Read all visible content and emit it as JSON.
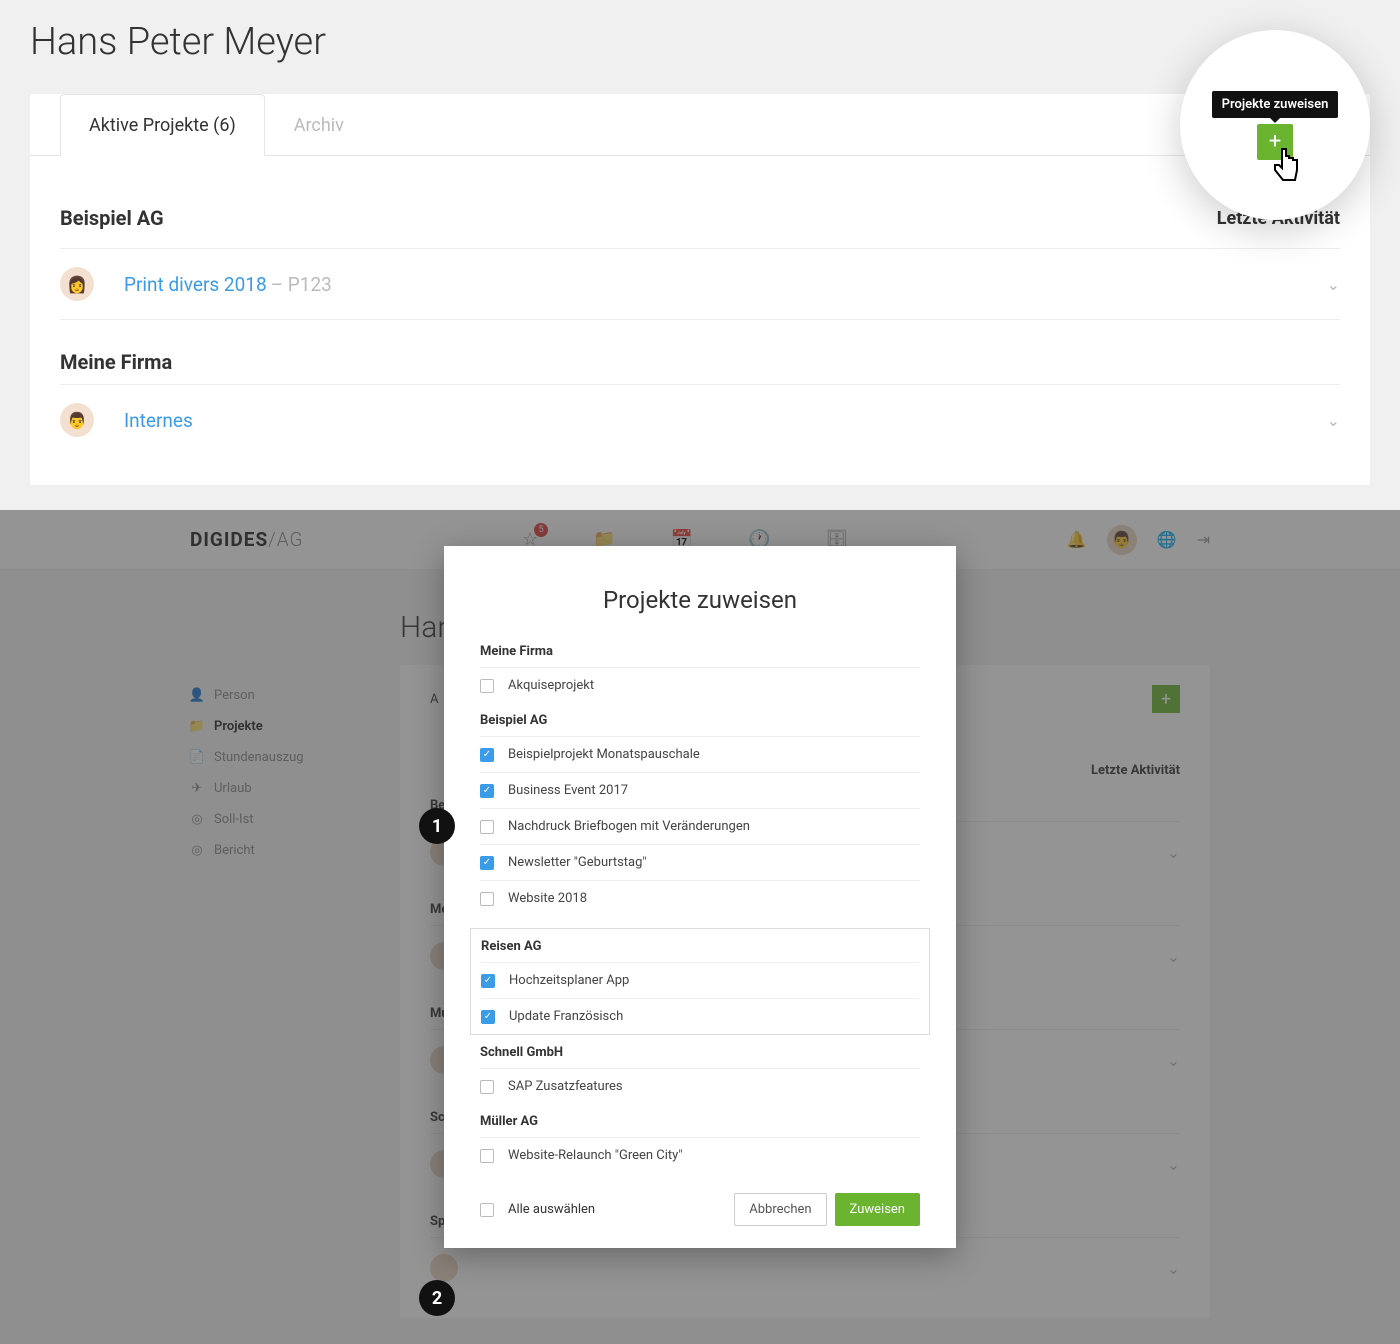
{
  "pageTitle": "Hans Peter Meyer",
  "tabs": {
    "active": "Aktive Projekte (6)",
    "archive": "Archiv"
  },
  "tooltip": "Projekte zuweisen",
  "activityHeader": "Letzte Aktivität",
  "notification_count": "5",
  "groups": [
    {
      "name": "Beispiel AG",
      "project": {
        "title": "Print divers 2018",
        "code": "– P123"
      }
    },
    {
      "name": "Meine Firma",
      "project": {
        "title": "Internes",
        "code": ""
      }
    }
  ],
  "brand": {
    "main": "DIGIDES",
    "suffix": "/AG"
  },
  "sidebar": [
    {
      "icon": "person-icon",
      "glyph": "👤",
      "label": "Person"
    },
    {
      "icon": "folder-icon",
      "glyph": "📁",
      "label": "Projekte"
    },
    {
      "icon": "document-icon",
      "glyph": "📄",
      "label": "Stundenauszug"
    },
    {
      "icon": "vacation-icon",
      "glyph": "✈",
      "label": "Urlaub"
    },
    {
      "icon": "target-icon",
      "glyph": "◎",
      "label": "Soll-Ist"
    },
    {
      "icon": "report-icon",
      "glyph": "◎",
      "label": "Bericht"
    }
  ],
  "backSections": [
    "Bei",
    "Mei",
    "Mu",
    "Sch",
    "Spi"
  ],
  "modal": {
    "title": "Projekte zuweisen",
    "groups": [
      {
        "name": "Meine Firma",
        "highlight": false,
        "items": [
          {
            "label": "Akquiseprojekt",
            "checked": false
          }
        ]
      },
      {
        "name": "Beispiel AG",
        "highlight": false,
        "items": [
          {
            "label": "Beispielprojekt Monatspauschale",
            "checked": true
          },
          {
            "label": "Business Event 2017",
            "checked": true
          },
          {
            "label": "Nachdruck Briefbogen mit Veränderungen",
            "checked": false
          },
          {
            "label": "Newsletter \"Geburtstag\"",
            "checked": true
          },
          {
            "label": "Website 2018",
            "checked": false
          }
        ]
      },
      {
        "name": "Reisen AG",
        "highlight": true,
        "items": [
          {
            "label": "Hochzeitsplaner App",
            "checked": true
          },
          {
            "label": "Update Französisch",
            "checked": true
          }
        ]
      },
      {
        "name": "Schnell GmbH",
        "highlight": false,
        "items": [
          {
            "label": "SAP Zusatzfeatures",
            "checked": false
          }
        ]
      },
      {
        "name": "Müller AG",
        "highlight": false,
        "items": [
          {
            "label": "Website-Relaunch \"Green City\"",
            "checked": false
          }
        ]
      }
    ],
    "selectAll": "Alle auswählen",
    "cancel": "Abbrechen",
    "submit": "Zuweisen"
  },
  "steps": {
    "one": "1",
    "two": "2"
  }
}
